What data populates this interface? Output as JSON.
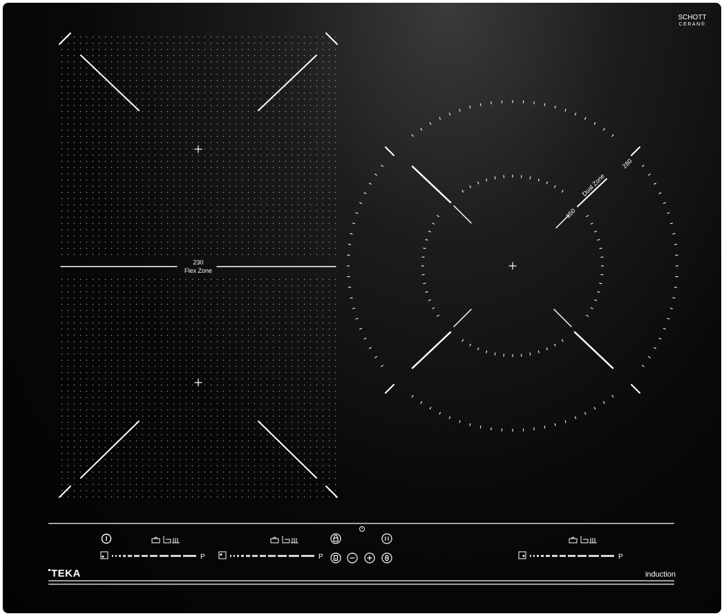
{
  "hob": {
    "glass_brand": {
      "line1": "SCHOTT",
      "line2": "CERAN®"
    },
    "brand": "TEKA",
    "type_label": "induction",
    "flex_zone": {
      "diameter": "230",
      "name": "Flex Zone"
    },
    "dual_zone": {
      "inner_diameter": "150",
      "outer_diameter": "280",
      "name": "Dual Zone"
    },
    "sliders": [
      {
        "end_label": "P"
      },
      {
        "end_label": "P"
      },
      {
        "end_label": "P"
      }
    ],
    "controls": {
      "icons": [
        "power-icon",
        "cookware-icons",
        "lock-icon",
        "timer-icon",
        "pause-icon",
        "keep-warm-icon",
        "minus-icon",
        "plus-icon",
        "stop-go-icon"
      ]
    },
    "colors": {
      "glass": "#050505",
      "markings": "#ffffff"
    }
  }
}
